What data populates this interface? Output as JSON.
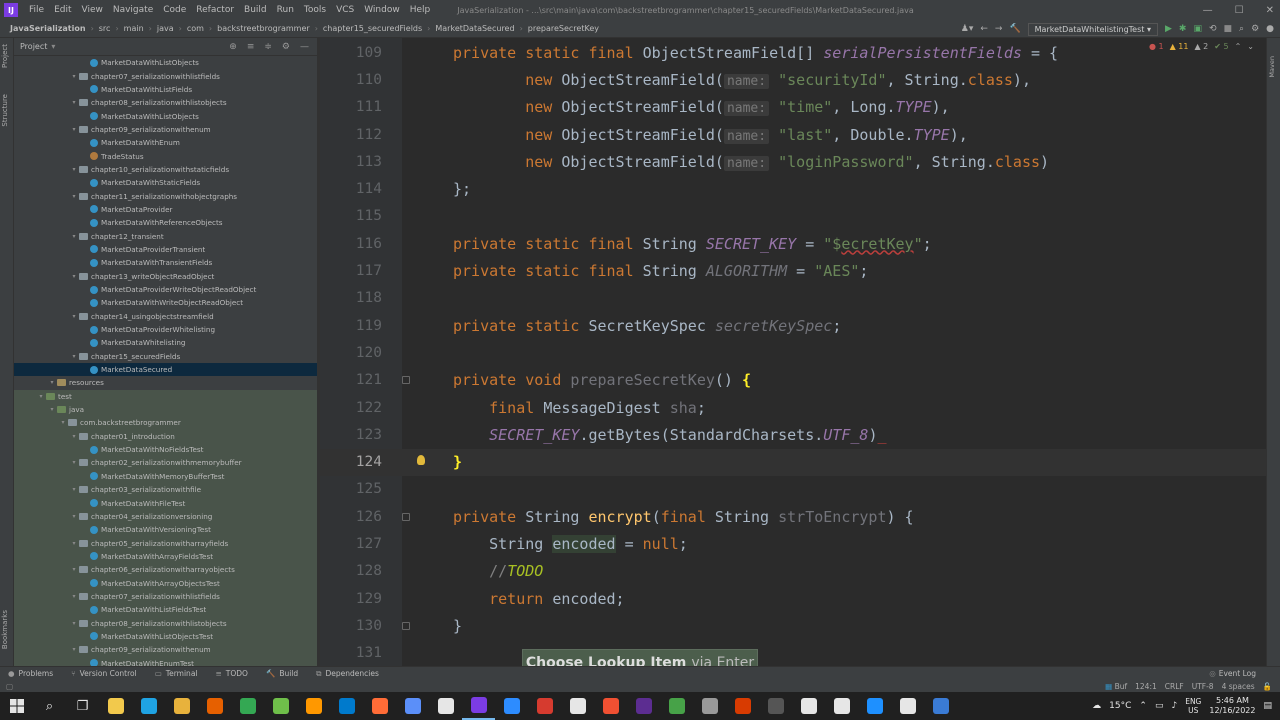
{
  "menubar": {
    "items": [
      "File",
      "Edit",
      "View",
      "Navigate",
      "Code",
      "Refactor",
      "Build",
      "Run",
      "Tools",
      "VCS",
      "Window",
      "Help"
    ],
    "window_title": "JavaSerialization - ...\\src\\main\\java\\com\\backstreetbrogrammer\\chapter15_securedFields\\MarketDataSecured.java"
  },
  "breadcrumbs": [
    "JavaSerialization",
    "src",
    "main",
    "java",
    "com",
    "backstreetbrogrammer",
    "chapter15_securedFields",
    "MarketDataSecured",
    "prepareSecretKey"
  ],
  "run_config": "MarketDataWhitelistingTest",
  "project_panel": {
    "title": "Project"
  },
  "side_tabs": {
    "project": "Project",
    "structure": "Structure",
    "bookmarks": "Bookmarks",
    "maven": "Maven"
  },
  "tree": [
    {
      "label": "MarketDataWithListObjects",
      "type": "class",
      "indent": 6
    },
    {
      "label": "chapter07_serializationwithlistfields",
      "type": "folder",
      "indent": 5
    },
    {
      "label": "MarketDataWithListFields",
      "type": "class",
      "indent": 6
    },
    {
      "label": "chapter08_serializationwithlistobjects",
      "type": "folder",
      "indent": 5
    },
    {
      "label": "MarketDataWithListObjects",
      "type": "class",
      "indent": 6
    },
    {
      "label": "chapter09_serializationwithenum",
      "type": "folder",
      "indent": 5
    },
    {
      "label": "MarketDataWithEnum",
      "type": "class",
      "indent": 6
    },
    {
      "label": "TradeStatus",
      "type": "enum",
      "indent": 6
    },
    {
      "label": "chapter10_serializationwithstaticfields",
      "type": "folder",
      "indent": 5
    },
    {
      "label": "MarketDataWithStaticFields",
      "type": "class",
      "indent": 6
    },
    {
      "label": "chapter11_serializationwithobjectgraphs",
      "type": "folder",
      "indent": 5
    },
    {
      "label": "MarketDataProvider",
      "type": "class",
      "indent": 6
    },
    {
      "label": "MarketDataWithReferenceObjects",
      "type": "class",
      "indent": 6
    },
    {
      "label": "chapter12_transient",
      "type": "folder",
      "indent": 5
    },
    {
      "label": "MarketDataProviderTransient",
      "type": "class",
      "indent": 6
    },
    {
      "label": "MarketDataWithTransientFields",
      "type": "class",
      "indent": 6
    },
    {
      "label": "chapter13_writeObjectReadObject",
      "type": "folder",
      "indent": 5
    },
    {
      "label": "MarketDataProviderWriteObjectReadObject",
      "type": "class",
      "indent": 6
    },
    {
      "label": "MarketDataWithWriteObjectReadObject",
      "type": "class",
      "indent": 6
    },
    {
      "label": "chapter14_usingobjectstreamfield",
      "type": "folder",
      "indent": 5
    },
    {
      "label": "MarketDataProviderWhitelisting",
      "type": "class",
      "indent": 6
    },
    {
      "label": "MarketDataWhitelisting",
      "type": "class",
      "indent": 6
    },
    {
      "label": "chapter15_securedFields",
      "type": "folder",
      "indent": 5
    },
    {
      "label": "MarketDataSecured",
      "type": "class",
      "indent": 6,
      "selected": true
    },
    {
      "label": "resources",
      "type": "res",
      "indent": 3
    },
    {
      "label": "test",
      "type": "tfolder",
      "indent": 2,
      "test": true
    },
    {
      "label": "java",
      "type": "tfolder",
      "indent": 3,
      "test": true
    },
    {
      "label": "com.backstreetbrogrammer",
      "type": "folder",
      "indent": 4,
      "test": true
    },
    {
      "label": "chapter01_introduction",
      "type": "folder",
      "indent": 5,
      "test": true
    },
    {
      "label": "MarketDataWithNoFieldsTest",
      "type": "class",
      "indent": 6,
      "test": true
    },
    {
      "label": "chapter02_serializationwithmemorybuffer",
      "type": "folder",
      "indent": 5,
      "test": true
    },
    {
      "label": "MarketDataWithMemoryBufferTest",
      "type": "class",
      "indent": 6,
      "test": true
    },
    {
      "label": "chapter03_serializationwithfile",
      "type": "folder",
      "indent": 5,
      "test": true
    },
    {
      "label": "MarketDataWithFileTest",
      "type": "class",
      "indent": 6,
      "test": true
    },
    {
      "label": "chapter04_serializationversioning",
      "type": "folder",
      "indent": 5,
      "test": true
    },
    {
      "label": "MarketDataWithVersioningTest",
      "type": "class",
      "indent": 6,
      "test": true
    },
    {
      "label": "chapter05_serializationwitharrayfields",
      "type": "folder",
      "indent": 5,
      "test": true
    },
    {
      "label": "MarketDataWithArrayFieldsTest",
      "type": "class",
      "indent": 6,
      "test": true
    },
    {
      "label": "chapter06_serializationwitharrayobjects",
      "type": "folder",
      "indent": 5,
      "test": true
    },
    {
      "label": "MarketDataWithArrayObjectsTest",
      "type": "class",
      "indent": 6,
      "test": true
    },
    {
      "label": "chapter07_serializationwithlistfields",
      "type": "folder",
      "indent": 5,
      "test": true
    },
    {
      "label": "MarketDataWithListFieldsTest",
      "type": "class",
      "indent": 6,
      "test": true
    },
    {
      "label": "chapter08_serializationwithlistobjects",
      "type": "folder",
      "indent": 5,
      "test": true
    },
    {
      "label": "MarketDataWithListObjectsTest",
      "type": "class",
      "indent": 6,
      "test": true
    },
    {
      "label": "chapter09_serializationwithenum",
      "type": "folder",
      "indent": 5,
      "test": true
    },
    {
      "label": "MarketDataWithEnumTest",
      "type": "class",
      "indent": 6,
      "test": true
    }
  ],
  "editor": {
    "lines": [
      {
        "n": "109",
        "html": "<span class='kw'>private static final </span>ObjectStreamField[] <span class='fld'>serialPersistentFields</span> = {"
      },
      {
        "n": "110",
        "html": "        <span class='kw'>new </span>ObjectStreamField(<span class='hint'>name:</span> <span class='str'>\"securityId\"</span>, String.<span class='kw'>class</span>),"
      },
      {
        "n": "111",
        "html": "        <span class='kw'>new </span>ObjectStreamField(<span class='hint'>name:</span> <span class='str'>\"time\"</span>, Long.<span class='fld'>TYPE</span>),"
      },
      {
        "n": "112",
        "html": "        <span class='kw'>new </span>ObjectStreamField(<span class='hint'>name:</span> <span class='str'>\"last\"</span>, Double.<span class='fld'>TYPE</span>),"
      },
      {
        "n": "113",
        "html": "        <span class='kw'>new </span>ObjectStreamField(<span class='hint'>name:</span> <span class='str'>\"loginPassword\"</span>, String.<span class='kw'>class</span>)"
      },
      {
        "n": "114",
        "html": "};"
      },
      {
        "n": "115",
        "html": ""
      },
      {
        "n": "116",
        "html": "<span class='kw'>private static final </span>String <span class='fld'>SECRET_KEY</span> = <span class='str'>\"$<span class='err'>ecretKey</span>\"</span>;"
      },
      {
        "n": "117",
        "html": "<span class='kw'>private static final </span>String <span class='fld' style='color:#72737a'>ALGORITHM</span> = <span class='str'>\"AES\"</span>;"
      },
      {
        "n": "118",
        "html": ""
      },
      {
        "n": "119",
        "html": "<span class='kw'>private static </span>SecretKeySpec <span class='fld' style='color:#72737a'>secretKeySpec</span>;"
      },
      {
        "n": "120",
        "html": ""
      },
      {
        "n": "121",
        "html": "<span class='kw'>private void </span><span class='unused'>prepareSecretKey</span>() <span class='brace'>{</span>"
      },
      {
        "n": "122",
        "html": "    <span class='kw'>final </span>MessageDigest <span class='unused'>sha</span>;"
      },
      {
        "n": "123",
        "html": "    <span class='fld'>SECRET_KEY</span>.getBytes(StandardCharsets.<span class='fld'>UTF_8</span>)<span style='color:#bc3f3c'>_</span>"
      },
      {
        "n": "124",
        "html": "<span class='brace'>}</span>",
        "current": true
      },
      {
        "n": "125",
        "html": ""
      },
      {
        "n": "126",
        "html": "<span class='kw'>private </span>String <span class='mth'>encrypt</span>(<span class='kw'>final </span>String <span class='unused'>strToEncrypt</span>) {"
      },
      {
        "n": "127",
        "html": "    String <span class='hl'>encoded</span> = <span class='kw'>null</span>;"
      },
      {
        "n": "128",
        "html": "    <span class='cmt'>//</span><span class='todo'>TODO</span>"
      },
      {
        "n": "129",
        "html": "    <span class='kw'>return </span>encoded;"
      },
      {
        "n": "130",
        "html": "}"
      },
      {
        "n": "131",
        "html": ""
      }
    ]
  },
  "inspections": {
    "errors": "1",
    "warnings": "11",
    "weak": "2",
    "typos": "5"
  },
  "popup": {
    "bold": "Choose Lookup Item",
    "rest": "via Enter"
  },
  "bottom_tabs": [
    "Problems",
    "Version Control",
    "Terminal",
    "TODO",
    "Build",
    "Dependencies"
  ],
  "event_log": "Event Log",
  "status": {
    "buf": "Buf",
    "pos": "124:1",
    "sep": "CRLF",
    "enc": "UTF-8",
    "indent": "4 spaces"
  },
  "tray": {
    "temp": "15°C",
    "lang1": "ENG",
    "lang2": "US",
    "time": "5:46 AM",
    "date": "12/16/2022"
  },
  "taskbar_apps": [
    {
      "name": "explorer-icon",
      "color": "#f2c94c"
    },
    {
      "name": "edge-icon",
      "color": "#1fa3e3"
    },
    {
      "name": "files-icon",
      "color": "#e8b23c"
    },
    {
      "name": "firefox-icon",
      "color": "#e66000"
    },
    {
      "name": "chrome-icon",
      "color": "#34a853"
    },
    {
      "name": "notepad-icon",
      "color": "#6fbf4a"
    },
    {
      "name": "sublime-icon",
      "color": "#ff9800"
    },
    {
      "name": "vscode-icon",
      "color": "#007acc"
    },
    {
      "name": "postman-icon",
      "color": "#ff6c37"
    },
    {
      "name": "app-icon",
      "color": "#5b8ff9"
    },
    {
      "name": "app2-icon",
      "color": "#e6e6e6"
    },
    {
      "name": "intellij-icon",
      "color": "#7b3ce3"
    },
    {
      "name": "zoom-icon",
      "color": "#2d8cff"
    },
    {
      "name": "app3-icon",
      "color": "#d63b2f"
    },
    {
      "name": "app4-icon",
      "color": "#e6e6e6"
    },
    {
      "name": "git-icon",
      "color": "#f05032"
    },
    {
      "name": "vs-icon",
      "color": "#5c2d91"
    },
    {
      "name": "mongodb-icon",
      "color": "#47a248"
    },
    {
      "name": "app5-icon",
      "color": "#999999"
    },
    {
      "name": "word-icon",
      "color": "#d83b01"
    },
    {
      "name": "cmd-icon",
      "color": "#555555"
    },
    {
      "name": "github-icon",
      "color": "#e6e6e6"
    },
    {
      "name": "maps-icon",
      "color": "#e6e6e6"
    },
    {
      "name": "app6-icon",
      "color": "#1e90ff"
    },
    {
      "name": "app7-icon",
      "color": "#e6e6e6"
    },
    {
      "name": "app8-icon",
      "color": "#3a7bd5"
    }
  ]
}
